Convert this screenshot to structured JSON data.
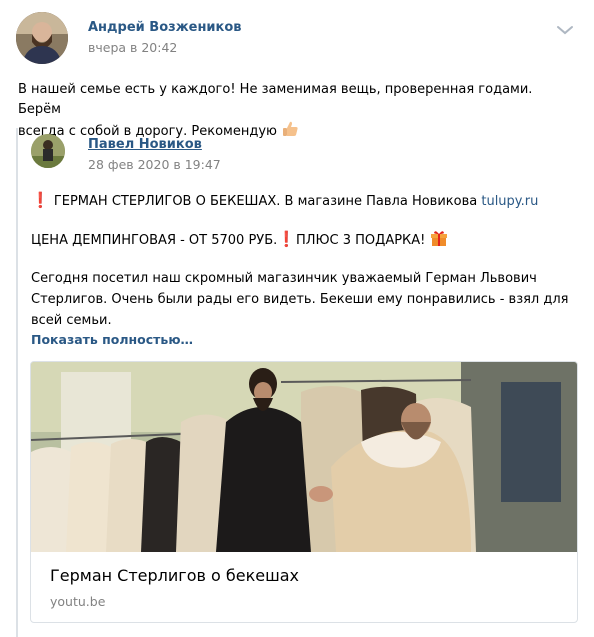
{
  "post": {
    "author": "Андрей Возжеников",
    "time": "вчера в 20:42",
    "text_line1": "В нашей семье есть у каждого! Не заменимая вещь, проверенная годами. Берём",
    "text_line2": "всегда с собой в дорогу. Рекомендую"
  },
  "repost": {
    "author": "Павел Новиков",
    "time": "28 фев 2020 в 19:47",
    "line1_text": "ГЕРМАН СТЕРЛИГОВ О БЕКЕШАХ. В магазине Павла Новикова",
    "line1_link": "tulupy.ru",
    "line2_text_a": "ЦЕНА ДЕМПИНГОВАЯ - ОТ 5700 РУБ.",
    "line2_text_b": "ПЛЮС 3 ПОДАРКА!",
    "para_line1": "Сегодня посетил наш скромный магазинчик уважаемый Герман Львович",
    "para_line2": "Стерлигов. Очень были рады его видеть. Бекеши ему понравились - взял для",
    "para_line3": "всей семьи.",
    "show_more": "Показать полностью…"
  },
  "card": {
    "title": "Герман Стерлигов о бекешах",
    "domain": "youtu.be"
  },
  "colors": {
    "link": "#2a5885",
    "meta": "#828282",
    "accent_red": "#e2231a",
    "border": "#dce1e6"
  },
  "icons": [
    "chevron-down-icon",
    "thumbs-up-icon",
    "exclamation-icon",
    "gift-icon"
  ]
}
